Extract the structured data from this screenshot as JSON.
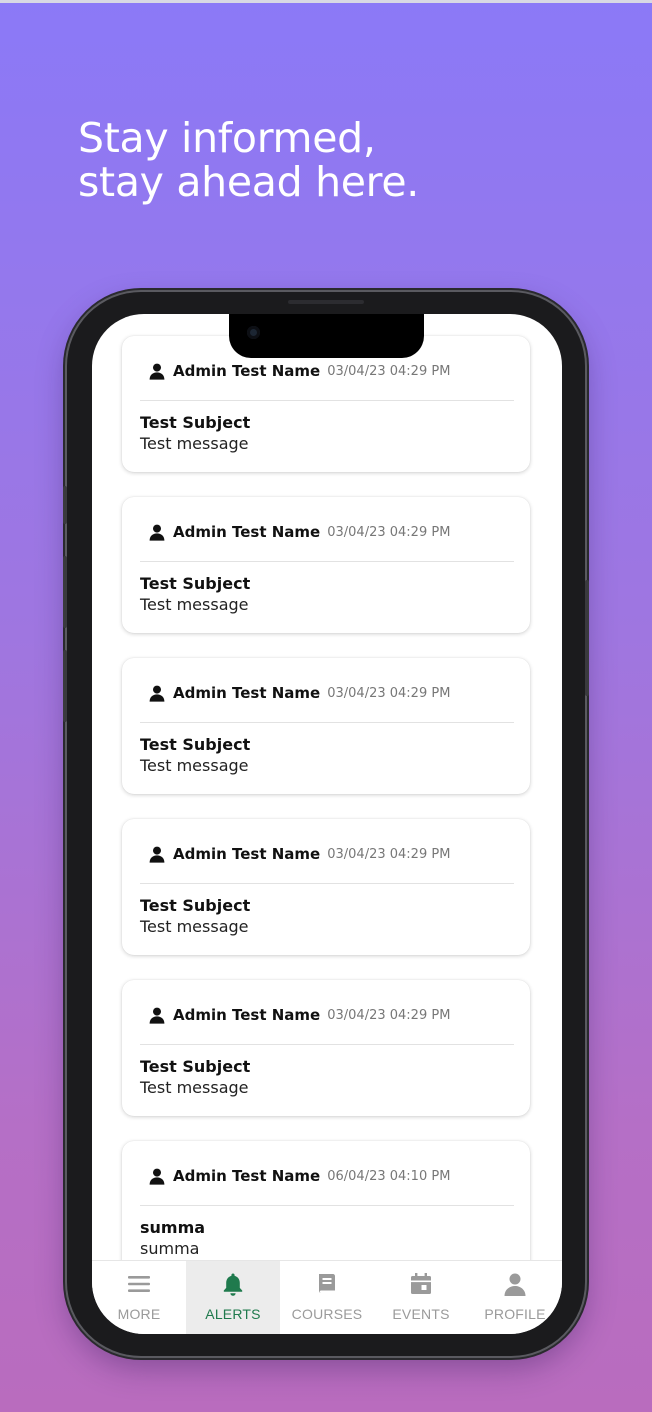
{
  "headline": {
    "line1": "Stay informed,",
    "line2": "stay ahead here."
  },
  "alerts": [
    {
      "sender": "Admin Test Name",
      "timestamp": "03/04/23 04:29 PM",
      "subject": "Test Subject",
      "message": "Test message"
    },
    {
      "sender": "Admin Test Name",
      "timestamp": "03/04/23 04:29 PM",
      "subject": "Test Subject",
      "message": "Test message"
    },
    {
      "sender": "Admin Test Name",
      "timestamp": "03/04/23 04:29 PM",
      "subject": "Test Subject",
      "message": "Test message"
    },
    {
      "sender": "Admin Test Name",
      "timestamp": "03/04/23 04:29 PM",
      "subject": "Test Subject",
      "message": "Test message"
    },
    {
      "sender": "Admin Test Name",
      "timestamp": "03/04/23 04:29 PM",
      "subject": "Test Subject",
      "message": "Test message"
    },
    {
      "sender": "Admin Test Name",
      "timestamp": "06/04/23 04:10 PM",
      "subject": "summa",
      "message": "summa"
    }
  ],
  "nav": {
    "active": "alerts",
    "tabs": [
      {
        "id": "more",
        "label": "MORE",
        "icon": "menu-icon"
      },
      {
        "id": "alerts",
        "label": "ALERTS",
        "icon": "bell-icon"
      },
      {
        "id": "courses",
        "label": "COURSES",
        "icon": "book-icon"
      },
      {
        "id": "events",
        "label": "EVENTS",
        "icon": "calendar-icon"
      },
      {
        "id": "profile",
        "label": "PROFILE",
        "icon": "person-icon"
      }
    ]
  },
  "colors": {
    "background_top": "#8b79f7",
    "background_bottom": "#b96cbe",
    "accent": "#1f7a4d",
    "inactive": "#9a9a9a"
  }
}
